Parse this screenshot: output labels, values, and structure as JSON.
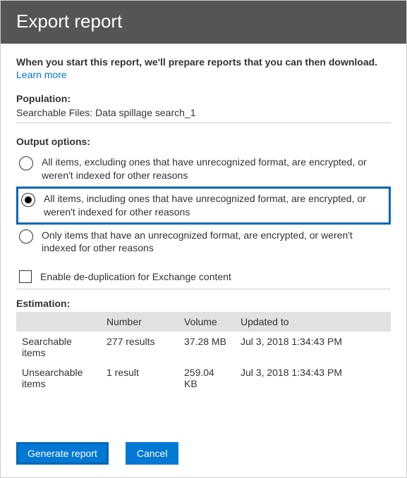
{
  "header": {
    "title": "Export report"
  },
  "intro": {
    "text": "When you start this report, we'll prepare reports that you can then download.",
    "learn_more": "Learn more"
  },
  "population": {
    "label": "Population:",
    "value": "Searchable Files:  Data spillage search_1"
  },
  "output": {
    "label": "Output options:",
    "options": [
      {
        "label": "All items, excluding ones that have unrecognized format, are encrypted, or weren't indexed for other reasons",
        "selected": false
      },
      {
        "label": "All items, including ones that have unrecognized format, are encrypted, or weren't indexed for other reasons",
        "selected": true
      },
      {
        "label": "Only items that have an unrecognized format, are encrypted, or weren't indexed for other reasons",
        "selected": false
      }
    ],
    "dedup_label": "Enable de-duplication for Exchange content",
    "dedup_checked": false
  },
  "estimation": {
    "label": "Estimation:",
    "columns": [
      "",
      "Number",
      "Volume",
      "Updated to"
    ],
    "rows": [
      {
        "name": "Searchable items",
        "number": "277 results",
        "volume": "37.28 MB",
        "updated": "Jul 3, 2018 1:34:43 PM"
      },
      {
        "name": "Unsearchable items",
        "number": "1 result",
        "volume": "259.04 KB",
        "updated": "Jul 3, 2018 1:34:43 PM"
      }
    ]
  },
  "buttons": {
    "generate": "Generate report",
    "cancel": "Cancel"
  }
}
